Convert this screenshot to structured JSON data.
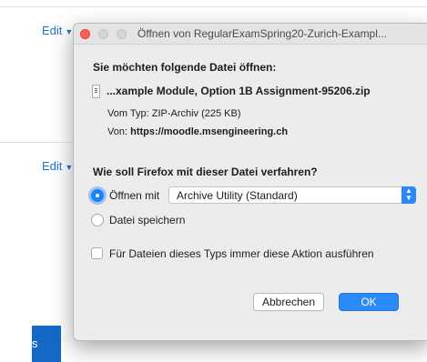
{
  "background": {
    "edit_label_1": "Edit",
    "edit_label_2": "Edit",
    "bottom_button_label": "s"
  },
  "dialog": {
    "title": "Öffnen von RegularExamSpring20-Zurich-Exampl...",
    "question_open": "Sie möchten folgende Datei öffnen:",
    "filename": "...xample Module, Option 1B Assignment-95206.zip",
    "type_label": "Vom Typ:",
    "type_value": "ZIP-Archiv (225 KB)",
    "from_label": "Von:",
    "from_value": "https://moodle.msengineering.ch",
    "question_action": "Wie soll Firefox mit dieser Datei verfahren?",
    "option_open_label": "Öffnen mit",
    "option_open_selected": true,
    "app_select_value": "Archive Utility (Standard)",
    "option_save_label": "Datei speichern",
    "option_save_selected": false,
    "always_checkbox_label": "Für Dateien dieses Typs immer diese Aktion ausführen",
    "always_checkbox_checked": false,
    "cancel_label": "Abbrechen",
    "ok_label": "OK"
  },
  "colors": {
    "accent": "#1a82fb",
    "close_button": "#ff5f57",
    "link": "#1c74d4"
  }
}
